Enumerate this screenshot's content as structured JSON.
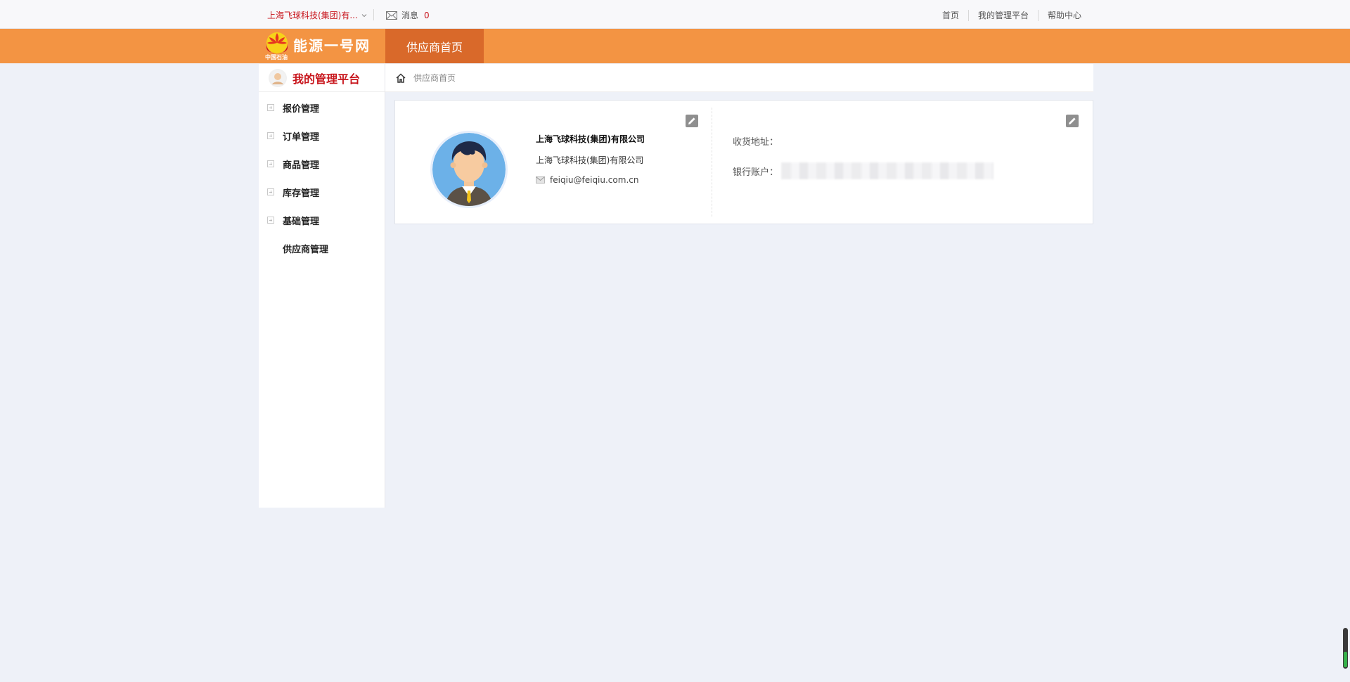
{
  "topbar": {
    "company": "上海飞球科技(集团)有...",
    "message_label": "消息",
    "message_count": "0",
    "links": [
      "首页",
      "我的管理平台",
      "帮助中心"
    ]
  },
  "header": {
    "brand": "能源一号网",
    "logo_caption": "中国石油",
    "nav_tab": "供应商首页",
    "bg_color": "#f39443",
    "tab_color": "#d9692a"
  },
  "sidebar": {
    "title": "我的管理平台",
    "items": [
      {
        "label": "报价管理",
        "expandable": true
      },
      {
        "label": "订单管理",
        "expandable": true
      },
      {
        "label": "商品管理",
        "expandable": true
      },
      {
        "label": "库存管理",
        "expandable": true
      },
      {
        "label": "基础管理",
        "expandable": true
      },
      {
        "label": "供应商管理",
        "expandable": false
      }
    ]
  },
  "breadcrumb": {
    "current": "供应商首页"
  },
  "profile": {
    "company_name": "上海飞球科技(集团)有限公司",
    "company_sub": "上海飞球科技(集团)有限公司",
    "email": "feiqiu@feiqiu.com.cn",
    "address_label": "收货地址：",
    "bank_label": "银行账户："
  },
  "colors": {
    "accent_red": "#c8161d",
    "page_bg": "#eef1f8"
  }
}
